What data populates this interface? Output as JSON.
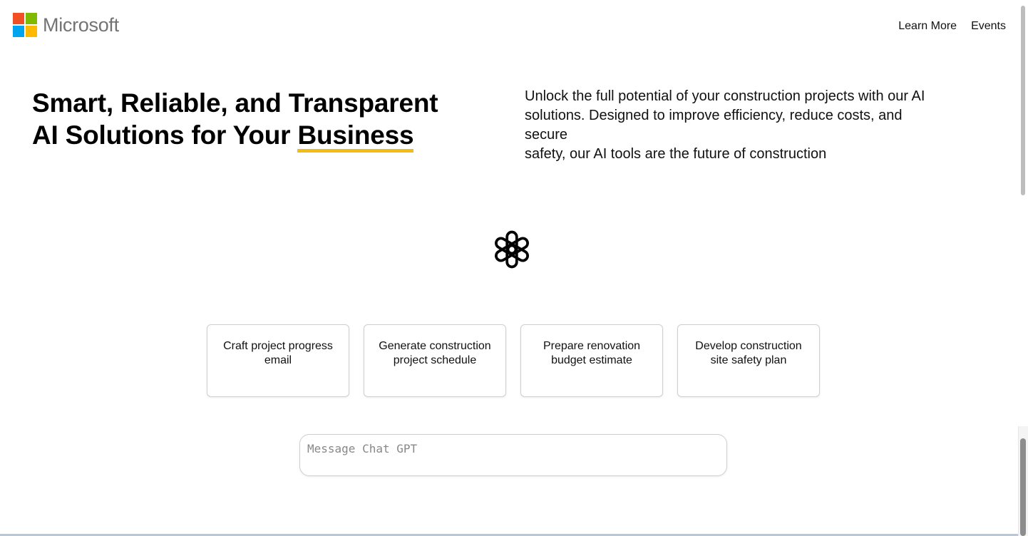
{
  "brand": {
    "name": "Microsoft",
    "colors": [
      "#f25022",
      "#7fba00",
      "#00a4ef",
      "#ffb900"
    ]
  },
  "nav": {
    "items": [
      {
        "label": "Learn More"
      },
      {
        "label": "Events"
      }
    ]
  },
  "hero": {
    "title_line1": "Smart, Reliable, and Transparent",
    "title_line2_prefix": "AI Solutions for Your ",
    "title_highlight": "Business",
    "highlight_color": "#f2bb16",
    "description_lines": [
      "Unlock the full potential of your construction projects with our AI",
      "solutions. Designed to improve efficiency, reduce costs, and",
      "secure",
      "safety, our AI tools are the future of construction"
    ]
  },
  "assistant": {
    "logo_icon": "openai-logo-icon"
  },
  "suggestions": [
    {
      "label": "Craft project progress email"
    },
    {
      "label": "Generate construction project schedule"
    },
    {
      "label": "Prepare renovation budget estimate"
    },
    {
      "label": "Develop construction site safety plan"
    }
  ],
  "message": {
    "placeholder": "Message Chat GPT",
    "value": ""
  }
}
